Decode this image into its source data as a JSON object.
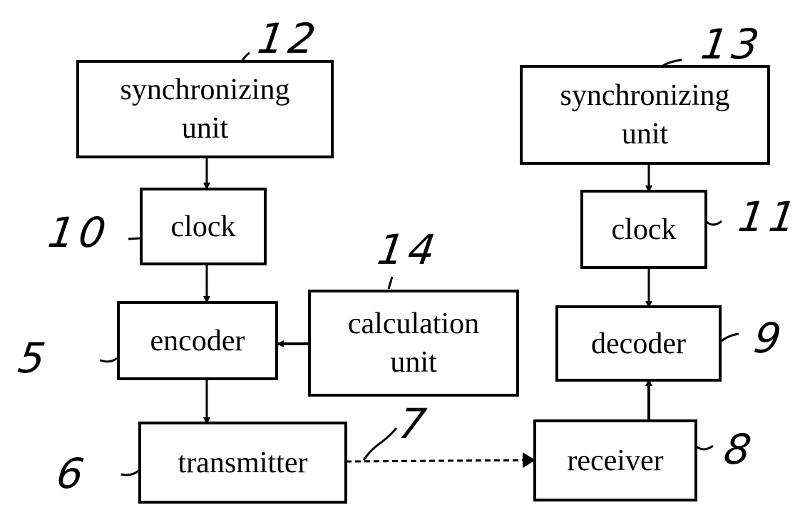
{
  "diagram": {
    "blocks": {
      "sync_left": {
        "lines": [
          "synchronizing",
          "unit"
        ],
        "ref": "12"
      },
      "clock_left": {
        "lines": [
          "clock"
        ],
        "ref": "10"
      },
      "encoder": {
        "lines": [
          "encoder"
        ],
        "ref": "5"
      },
      "calc": {
        "lines": [
          "calculation",
          "unit"
        ],
        "ref": "14"
      },
      "transmitter": {
        "lines": [
          "transmitter"
        ],
        "ref": "6"
      },
      "sync_right": {
        "lines": [
          "synchronizing",
          "unit"
        ],
        "ref": "13"
      },
      "clock_right": {
        "lines": [
          "clock"
        ],
        "ref": "11"
      },
      "decoder": {
        "lines": [
          "decoder"
        ],
        "ref": "9"
      },
      "receiver": {
        "lines": [
          "receiver"
        ],
        "ref": "8"
      }
    },
    "link_ref": "7",
    "connections": [
      {
        "from": "synchronizing unit (12)",
        "to": "clock (10)",
        "style": "solid"
      },
      {
        "from": "clock (10)",
        "to": "encoder (5)",
        "style": "solid"
      },
      {
        "from": "calculation unit (14)",
        "to": "encoder (5)",
        "style": "solid"
      },
      {
        "from": "encoder (5)",
        "to": "transmitter (6)",
        "style": "solid"
      },
      {
        "from": "transmitter (6)",
        "to": "receiver (8)",
        "style": "dashed"
      },
      {
        "from": "synchronizing unit (13)",
        "to": "clock (11)",
        "style": "solid"
      },
      {
        "from": "clock (11)",
        "to": "decoder (9)",
        "style": "solid"
      },
      {
        "from": "receiver (8)",
        "to": "decoder (9)",
        "style": "solid"
      }
    ]
  }
}
